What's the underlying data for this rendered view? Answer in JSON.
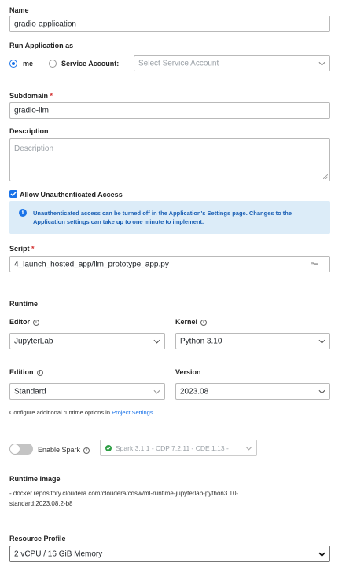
{
  "name": {
    "label": "Name",
    "value": "gradio-application"
  },
  "run_as": {
    "label": "Run Application as",
    "option_me": "me",
    "option_service": "Service Account:",
    "service_placeholder": "Select Service Account"
  },
  "subdomain": {
    "label": "Subdomain",
    "required_mark": "*",
    "value": "gradio-llm"
  },
  "description": {
    "label": "Description",
    "placeholder": "Description"
  },
  "unauth": {
    "label": "Allow Unauthenticated Access",
    "checked": true,
    "info_line1": "Unauthenticated access can be turned off in the Application's Settings page. Changes to the",
    "info_line2": "Application settings can take up to one minute to implement."
  },
  "script": {
    "label": "Script",
    "required_mark": "*",
    "value": "4_launch_hosted_app/llm_prototype_app.py"
  },
  "runtime": {
    "heading": "Runtime",
    "editor_label": "Editor",
    "editor_value": "JupyterLab",
    "kernel_label": "Kernel",
    "kernel_value": "Python 3.10",
    "edition_label": "Edition",
    "edition_value": "Standard",
    "version_label": "Version",
    "version_value": "2023.08",
    "config_text": "Configure additional runtime options in ",
    "config_link": "Project Settings",
    "config_end": "."
  },
  "spark": {
    "label": "Enable Spark",
    "select_value": "Spark 3.1.1 - CDP 7.2.11 - CDE 1.13 -"
  },
  "runtime_image": {
    "heading": "Runtime Image",
    "line1": "- docker.repository.cloudera.com/cloudera/cdsw/ml-runtime-jupyterlab-python3.10-",
    "line2": "standard:2023.08.2-b8"
  },
  "resource_profile": {
    "label": "Resource Profile",
    "value": "2 vCPU / 16 GiB Memory"
  },
  "colors": {
    "accent": "#1a73e8",
    "info_bg": "#dcecf8",
    "required": "#d32f2f"
  }
}
